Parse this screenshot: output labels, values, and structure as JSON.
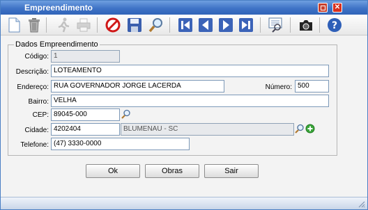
{
  "window": {
    "title": "Empreendimento"
  },
  "toolbar": {
    "icons": [
      "new-document-icon",
      "trash-icon",
      "run-icon",
      "print-icon",
      "cancel-icon",
      "save-icon",
      "search-icon",
      "first-record-icon",
      "previous-record-icon",
      "next-record-icon",
      "last-record-icon",
      "report-icon",
      "camera-icon",
      "help-icon"
    ]
  },
  "form": {
    "legend": "Dados Empreendimento",
    "codigo": {
      "label": "Código:",
      "value": "1"
    },
    "descricao": {
      "label": "Descrição:",
      "value": "LOTEAMENTO"
    },
    "endereco": {
      "label": "Endereço:",
      "value": "RUA GOVERNADOR JORGE LACERDA"
    },
    "numero": {
      "label": "Número:",
      "value": "500"
    },
    "bairro": {
      "label": "Bairro:",
      "value": "VELHA"
    },
    "cep": {
      "label": "CEP:",
      "value": "89045-000"
    },
    "cidade": {
      "label": "Cidade:",
      "code": "4202404",
      "name": "BLUMENAU - SC"
    },
    "telefone": {
      "label": "Telefone:",
      "value": "(47) 3330-0000"
    }
  },
  "buttons": {
    "ok": "Ok",
    "obras": "Obras",
    "sair": "Sair"
  }
}
